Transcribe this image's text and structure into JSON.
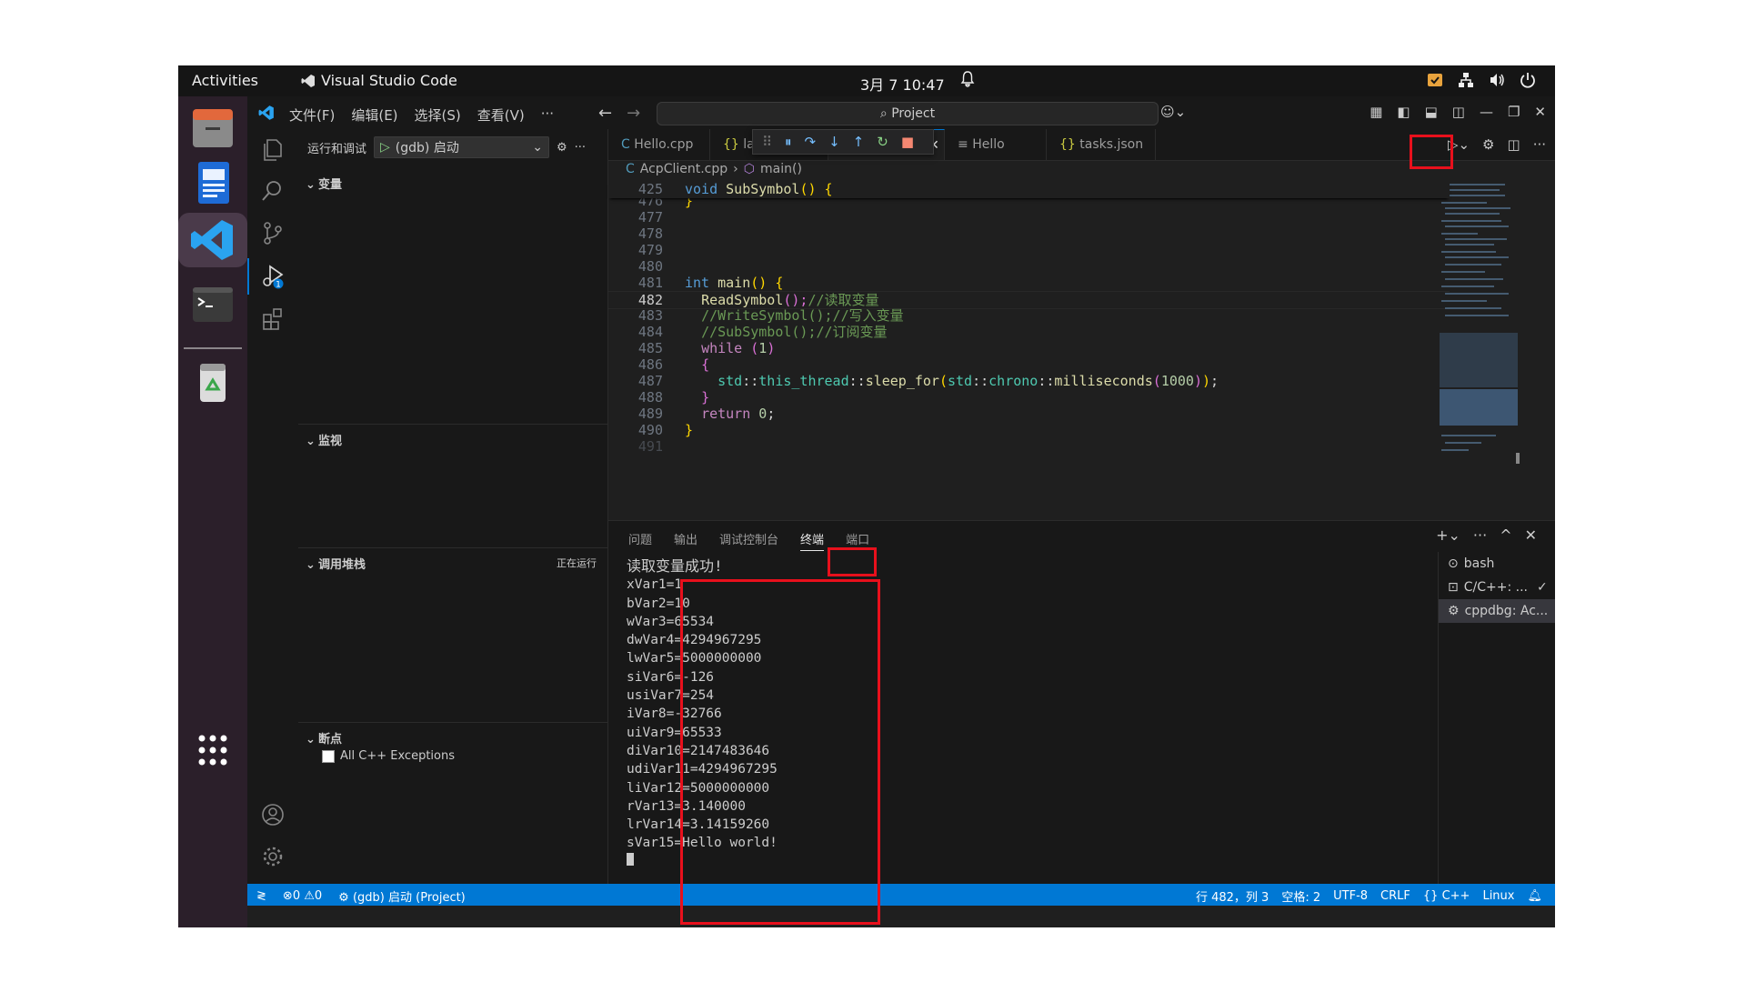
{
  "topbar": {
    "activities": "Activities",
    "app_name": "Visual Studio Code",
    "clock": "3月 7  10:47"
  },
  "menu": {
    "file": "文件(F)",
    "edit": "编辑(E)",
    "selection": "选择(S)",
    "view": "查看(V)",
    "more": "···"
  },
  "command_center": "Project",
  "sidebar": {
    "title": "运行和调试",
    "launch_config": "(gdb) 启动",
    "variables": "变量",
    "watch": "监视",
    "call_stack": "调用堆栈",
    "call_stack_status": "正在运行",
    "breakpoints": "断点",
    "breakpoint_item": "All C++ Exceptions"
  },
  "tabs": [
    {
      "label": "Hello.cpp",
      "icon": "C"
    },
    {
      "label": "lau",
      "icon": "{}"
    },
    {
      "label": "pp",
      "icon": ""
    },
    {
      "label": "Hello",
      "icon": "≡"
    },
    {
      "label": "tasks.json",
      "icon": "{}"
    }
  ],
  "breadcrumb": {
    "file": "AcpClient.cpp",
    "symbol": "main()"
  },
  "editor": {
    "sticky": {
      "num": "425",
      "code": "void SubSymbol() {"
    },
    "lines": [
      "476",
      "477",
      "478",
      "479",
      "480",
      "481",
      "482",
      "483",
      "484",
      "485",
      "486",
      "487",
      "488",
      "489",
      "490",
      "491"
    ],
    "code": {
      "l476": "}",
      "l481_kw": "int",
      "l481_fn": "main",
      "l481_rest": "() {",
      "l482_fn": "ReadSymbol",
      "l482_rest": "();",
      "l482_cm": "//读取变量",
      "l483_cm": "//WriteSymbol();//写入变量",
      "l484_cm": "//SubSymbol();//订阅变量",
      "l485_kw": "while",
      "l485_num": "1",
      "l486": "{",
      "l487_ns1": "std",
      "l487_fn1": "this_thread",
      "l487_fn2": "sleep_for",
      "l487_ns2": "std",
      "l487_ns3": "chrono",
      "l487_fn3": "milliseconds",
      "l487_num": "1000",
      "l488": "}",
      "l489_kw": "return",
      "l489_num": "0",
      "l490": "}"
    }
  },
  "panel": {
    "tabs": [
      "问题",
      "输出",
      "调试控制台",
      "终端",
      "端口"
    ],
    "active_tab": "终端",
    "terminal_lines": [
      "读取变量成功!",
      "xVar1=1",
      "bVar2=10",
      "wVar3=65534",
      "dwVar4=4294967295",
      "lwVar5=5000000000",
      "siVar6=-126",
      "usiVar7=254",
      "iVar8=-32766",
      "uiVar9=65533",
      "diVar10=2147483646",
      "udiVar11=4294967295",
      "liVar12=5000000000",
      "rVar13=3.140000",
      "lrVar14=3.14159260",
      "sVar15=Hello world!"
    ],
    "terminals": [
      "bash",
      "C/C++: ...",
      "cppdbg: Ac..."
    ]
  },
  "statusbar": {
    "errors": "0",
    "warnings": "0",
    "debug": "(gdb) 启动 (Project)",
    "position": "行 482，列 3",
    "spaces": "空格: 2",
    "encoding": "UTF-8",
    "eol": "CRLF",
    "language": "C++",
    "os": "Linux"
  },
  "colors": {
    "accent": "#0078d4",
    "annotation": "#e8101c"
  }
}
